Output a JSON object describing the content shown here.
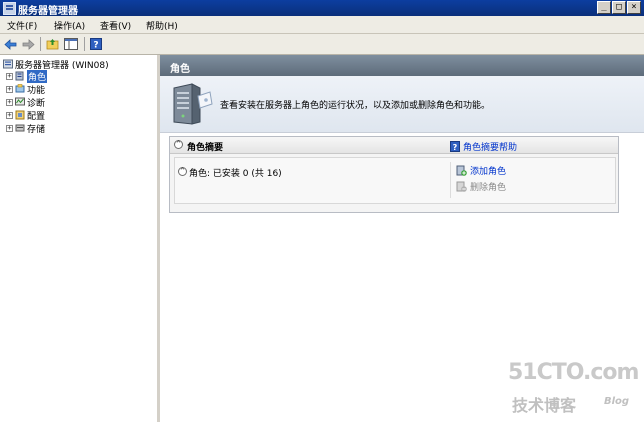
{
  "window": {
    "title": "服务器管理器",
    "controls": {
      "minimize": "_",
      "maximize": "□",
      "close": "×"
    }
  },
  "menu": {
    "items": [
      "文件(F)",
      "操作(A)",
      "查看(V)",
      "帮助(H)"
    ]
  },
  "toolbar": {
    "icons": [
      "back-arrow-icon",
      "forward-arrow-icon",
      "up-folder-icon",
      "show-hide-tree-icon",
      "help-icon"
    ]
  },
  "tree": {
    "root": "服务器管理器 (WIN08)",
    "items": [
      {
        "label": "角色",
        "icon": "roles-icon",
        "selected": true
      },
      {
        "label": "功能",
        "icon": "features-icon"
      },
      {
        "label": "诊断",
        "icon": "diagnostics-icon"
      },
      {
        "label": "配置",
        "icon": "configuration-icon"
      },
      {
        "label": "存储",
        "icon": "storage-icon"
      }
    ]
  },
  "main": {
    "header": "角色",
    "intro": "查看安装在服务器上角色的运行状况，以及添加或删除角色和功能。",
    "summary": {
      "title": "角色摘要",
      "help": "角色摘要帮助",
      "roles_line": "角色: 已安装 0 (共 16)",
      "add_role": "添加角色",
      "remove_role": "删除角色"
    }
  },
  "watermark": {
    "main": "51CTO.com",
    "sub": "技术博客",
    "blog": "Blog"
  },
  "colors": {
    "titlebar": "#0a2f7a",
    "pane_header": "#6e7d8c",
    "selection": "#316ac5",
    "link": "#0033cc"
  }
}
